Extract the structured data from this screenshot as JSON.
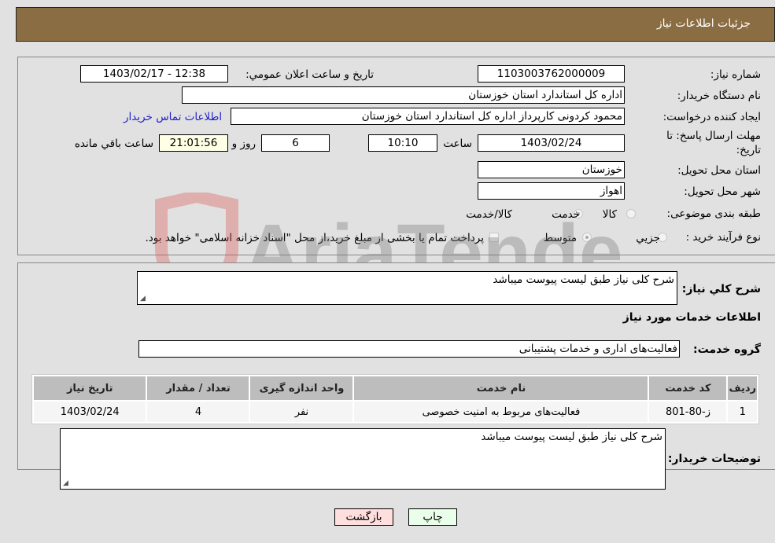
{
  "header": {
    "title": "جزئيات اطلاعات نياز"
  },
  "fields": {
    "need_number": {
      "label": "شماره نياز:",
      "value": "1103003762000009"
    },
    "announce_datetime": {
      "label": "تاريخ و ساعت اعلان عمومي:",
      "value": "1403/02/17 - 12:38"
    },
    "buyer_org": {
      "label": "نام دستگاه خريدار:",
      "value": "اداره کل استاندارد استان خوزستان"
    },
    "requester": {
      "label": "ايجاد کننده درخواست:",
      "value": "محمود کردونی کارپرداز اداره کل استاندارد استان خوزستان"
    },
    "buyer_contact_link": "اطلاعات تماس خريدار",
    "deadline": {
      "label_line1": "مهلت ارسال پاسخ: تا",
      "label_line2": "تاريخ:",
      "date": "1403/02/24",
      "time_label": "ساعت",
      "time": "10:10",
      "days": "6",
      "days_label": "روز و",
      "remaining": "21:01:56",
      "remaining_label": "ساعت باقي مانده"
    },
    "delivery_province": {
      "label": "استان محل تحويل:",
      "value": "خوزستان"
    },
    "delivery_city": {
      "label": "شهر محل تحويل:",
      "value": "اهواز"
    },
    "category": {
      "label": "طبقه بندی موضوعی:",
      "options": [
        "کالا",
        "خدمت",
        "کالا/خدمت"
      ],
      "selected": "خدمت"
    },
    "purchase_type": {
      "label": "نوع فرآيند خريد :",
      "options": [
        "جزيي",
        "متوسط"
      ],
      "selected": "متوسط",
      "treasury_note": "پرداخت تمام يا بخشی از مبلغ خريد،از محل \"اسناد خزانه اسلامی\" خواهد بود.",
      "treasury_checked": false
    }
  },
  "summary": {
    "label": "شرح کلي نياز:",
    "value": "شرح کلی نیاز طبق لیست پیوست میباشد"
  },
  "services_section_title": "اطلاعات خدمات مورد نياز",
  "service_group": {
    "label": "گروه خدمت:",
    "value": "فعالیت‌های اداری و خدمات پشتیبانی"
  },
  "table": {
    "headers": [
      "رديف",
      "کد خدمت",
      "نام خدمت",
      "واحد اندازه گيری",
      "تعداد / مقدار",
      "تاريخ نياز"
    ],
    "rows": [
      [
        "1",
        "ز-80-801",
        "فعالیت‌های مربوط به امنیت خصوصی",
        "نفر",
        "4",
        "1403/02/24"
      ]
    ]
  },
  "buyer_notes": {
    "label": "توضيحات خريدار:",
    "value": "شرح کلی نیاز طبق لیست پیوست میباشد"
  },
  "buttons": {
    "print": "چاپ",
    "back": "بازگشت"
  },
  "watermark": "AriaTender.neT",
  "colors": {
    "header_bg": "#8b6d43",
    "print_btn_bg": "#eaffea",
    "back_btn_bg": "#ffdede",
    "link": "#2222cc"
  }
}
